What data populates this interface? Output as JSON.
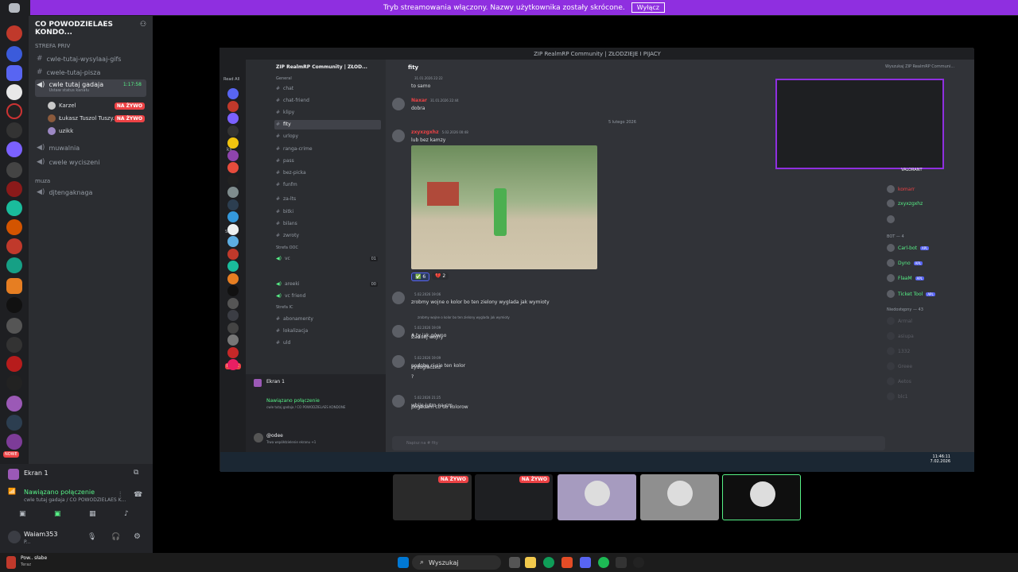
{
  "banner": {
    "text": "Tryb streamowania włączony. Nazwy użytkownika zostały skrócone.",
    "button": "Wyłącz"
  },
  "left": {
    "server_name": "CO POWODZIELAES KONDO...",
    "category": "STREFA PRIV",
    "channels": [
      {
        "label": "cwle-tutaj-wysylaaj-gifs",
        "type": "text"
      },
      {
        "label": "cwele-tutaj-pisza",
        "type": "text"
      },
      {
        "label": "cwle tutaj gadaja",
        "type": "voice",
        "active": true,
        "time": "1:17:58",
        "status": "Ustaw status kanału"
      }
    ],
    "voice_users": [
      {
        "name": "Karzel",
        "live": "NA ŻYWO"
      },
      {
        "name": "Łukasz Tuszol Tuszy...",
        "live": "NA ŻYWO"
      },
      {
        "name": "uzikk",
        "live": ""
      }
    ],
    "channels2": [
      {
        "label": "muwalnia",
        "type": "voice"
      },
      {
        "label": "cwele wyciszeni",
        "type": "voice"
      }
    ],
    "category2": "muza",
    "channels3": [
      {
        "label": "djtengaknaga",
        "type": "voice"
      }
    ],
    "screen_label": "Ekran 1",
    "connected": "Nawiązano połączenie",
    "connected_sub": "cwle tutaj gadaja / CO POWODZIELAES K...",
    "user_name": "Waiam353",
    "user_status": "P...",
    "nowe": "NOWE"
  },
  "window": {
    "title": "ZIP RealmRP Community | ZŁODZIEJE I PIJACY",
    "read_all": "Read All",
    "server": "ZIP RealmRP Community | ZŁOD...",
    "channel_header": "fity",
    "category_general": "General",
    "channels": [
      "chat",
      "chat-friend",
      "klipy",
      "fity",
      "urlopy",
      "ranga-crime",
      "pass",
      "bez-picka",
      "funfm"
    ],
    "channels_b": [
      "za-lts",
      "bitki",
      "bilans",
      "zwroty"
    ],
    "category_ooc": "Strefa OOC",
    "voice_ooc": [
      "vc",
      "areeki",
      "vc friend"
    ],
    "voice_counts": [
      "01",
      "00"
    ],
    "category_ic": "Strefa IC",
    "channels_ic": [
      "abonamenty",
      "lokalizacja",
      "uld"
    ],
    "screen": "Ekran 1",
    "connected": "Nawiązano połączenie",
    "connected_sub": "cwle tutaj gadaja / CO POWODZIELAES KONDONE",
    "user": "@odee",
    "user_sub": "Trwa współdzielenie ekranu +1",
    "nowe": "NOWE",
    "subw": "SubyW",
    "ks": "ks",
    "search": "Wyszukaj ZIP RealmRP Communi...",
    "date_divider": "5 lutego 2026",
    "messages": [
      {
        "name": "",
        "time": "31.01.2026 22:22",
        "text": "to samo"
      },
      {
        "name": "Naxar",
        "time": "31.01.2026 22:44",
        "text": "dobra"
      },
      {
        "name": "zxyxzgxhz",
        "time": "5.02.2026 00:48",
        "text": "lub bez kamzy"
      },
      {
        "name": "",
        "time": "5.02.2026 19:06",
        "text": "zrobmy wojne o kolor bo ten zielony wyglada jak wymioty"
      },
      {
        "name": "",
        "time": "5.02.2026 19:09",
        "text": "A ty jak gówno"
      },
      {
        "name": "",
        "time": "",
        "text": "Żadnej wojny"
      },
      {
        "name": "",
        "time": "5.02.2026 19:09",
        "text": "podoba ci sie ten kolor"
      },
      {
        "name": "",
        "time": "",
        "text": "zydoglaczku"
      },
      {
        "name": "",
        "time": "",
        "text": "?"
      },
      {
        "name": "",
        "time": "5.02.2026 21:25",
        "text": "wbije jutro na cm"
      },
      {
        "name": "",
        "time": "",
        "text": "pogadam co do kolorow"
      }
    ],
    "reply_quote": "zrobmy wojne o kolor bo ten zielony wyglada jak wymioty",
    "reactions": [
      "6",
      "2"
    ],
    "input_placeholder": "Napisz na # fity",
    "members": [
      {
        "name": "komarr",
        "color": "#ed4245"
      },
      {
        "name": "zxyxzgxhz",
        "color": "#57f287"
      },
      {
        "name": "",
        "color": "#dbdee1"
      },
      {
        "name": "Carl-bot",
        "color": "#57f287",
        "tag": "APL"
      },
      {
        "name": "Dyno",
        "color": "#57f287",
        "tag": "APL"
      },
      {
        "name": "FlaaM",
        "color": "#57f287",
        "tag": "APL"
      },
      {
        "name": "Ticket Tool",
        "color": "#57f287",
        "tag": "APL"
      }
    ],
    "member_cats": [
      "BOT — 4",
      "Niedostępny — 43"
    ],
    "offline": [
      "Arrnal",
      "asiupa",
      "1332",
      "Greee",
      "Aetos",
      "blc1"
    ],
    "valorant": "VALORANT",
    "clock": "11:46:11",
    "clock_date": "7.02.2026"
  },
  "tiles": [
    {
      "live": "NA ŻYWO"
    },
    {
      "live": "NA ŻYWO"
    },
    {
      "live": ""
    },
    {
      "live": ""
    },
    {
      "live": ""
    }
  ],
  "taskbar": {
    "search": "Wyszukaj",
    "notif_title": "Pow.. słabe",
    "notif_sub": "Teraz"
  }
}
